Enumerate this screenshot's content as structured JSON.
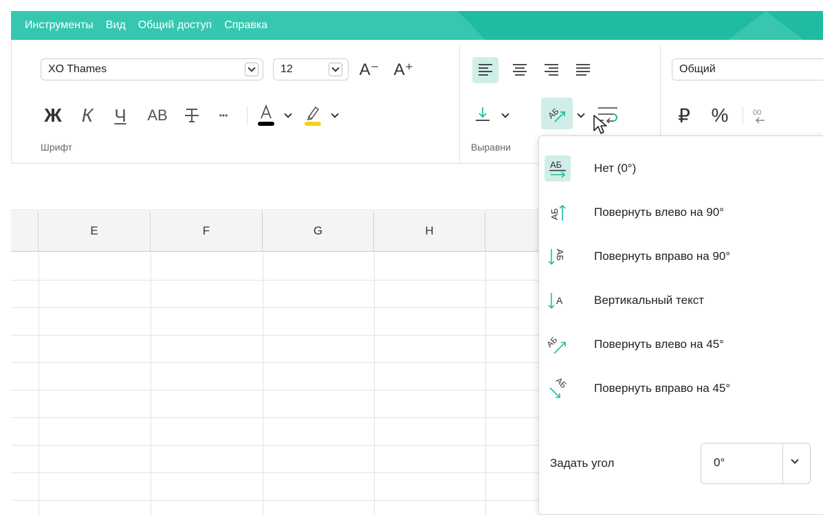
{
  "menu": {
    "items": [
      "Инструменты",
      "Вид",
      "Общий доступ",
      "Справка"
    ]
  },
  "ribbon": {
    "font": {
      "name": "XO Thames",
      "size": "12",
      "grow_label": "A⁻",
      "shrink_label": "A⁺",
      "bold": "Ж",
      "italic": "К",
      "underline": "Ч",
      "caps": "АВ",
      "more": "•••",
      "group_label": "Шрифт"
    },
    "align": {
      "group_label": "Выравни"
    },
    "number": {
      "format": "Общий",
      "currency": "₽",
      "percent": "%"
    }
  },
  "grid": {
    "columns": [
      "E",
      "F",
      "G",
      "H"
    ]
  },
  "dropdown": {
    "items": [
      {
        "label": "Нет (0°)",
        "icon": "text-angle-none-icon",
        "selected": true
      },
      {
        "label": "Повернуть влево на 90°",
        "icon": "rotate-up-icon"
      },
      {
        "label": "Повернуть вправо на 90°",
        "icon": "rotate-down-icon"
      },
      {
        "label": "Вертикальный текст",
        "icon": "vertical-text-icon"
      },
      {
        "label": "Повернуть влево на 45°",
        "icon": "angle-counterclockwise-icon"
      },
      {
        "label": "Повернуть вправо на 45°",
        "icon": "angle-clockwise-icon"
      }
    ],
    "angle_label": "Задать угол",
    "angle_value": "0°"
  },
  "colors": {
    "accent": "#20bca2",
    "font_color": "#000000",
    "highlight_color": "#f5d11c",
    "selected_bg": "#cfeee8"
  }
}
